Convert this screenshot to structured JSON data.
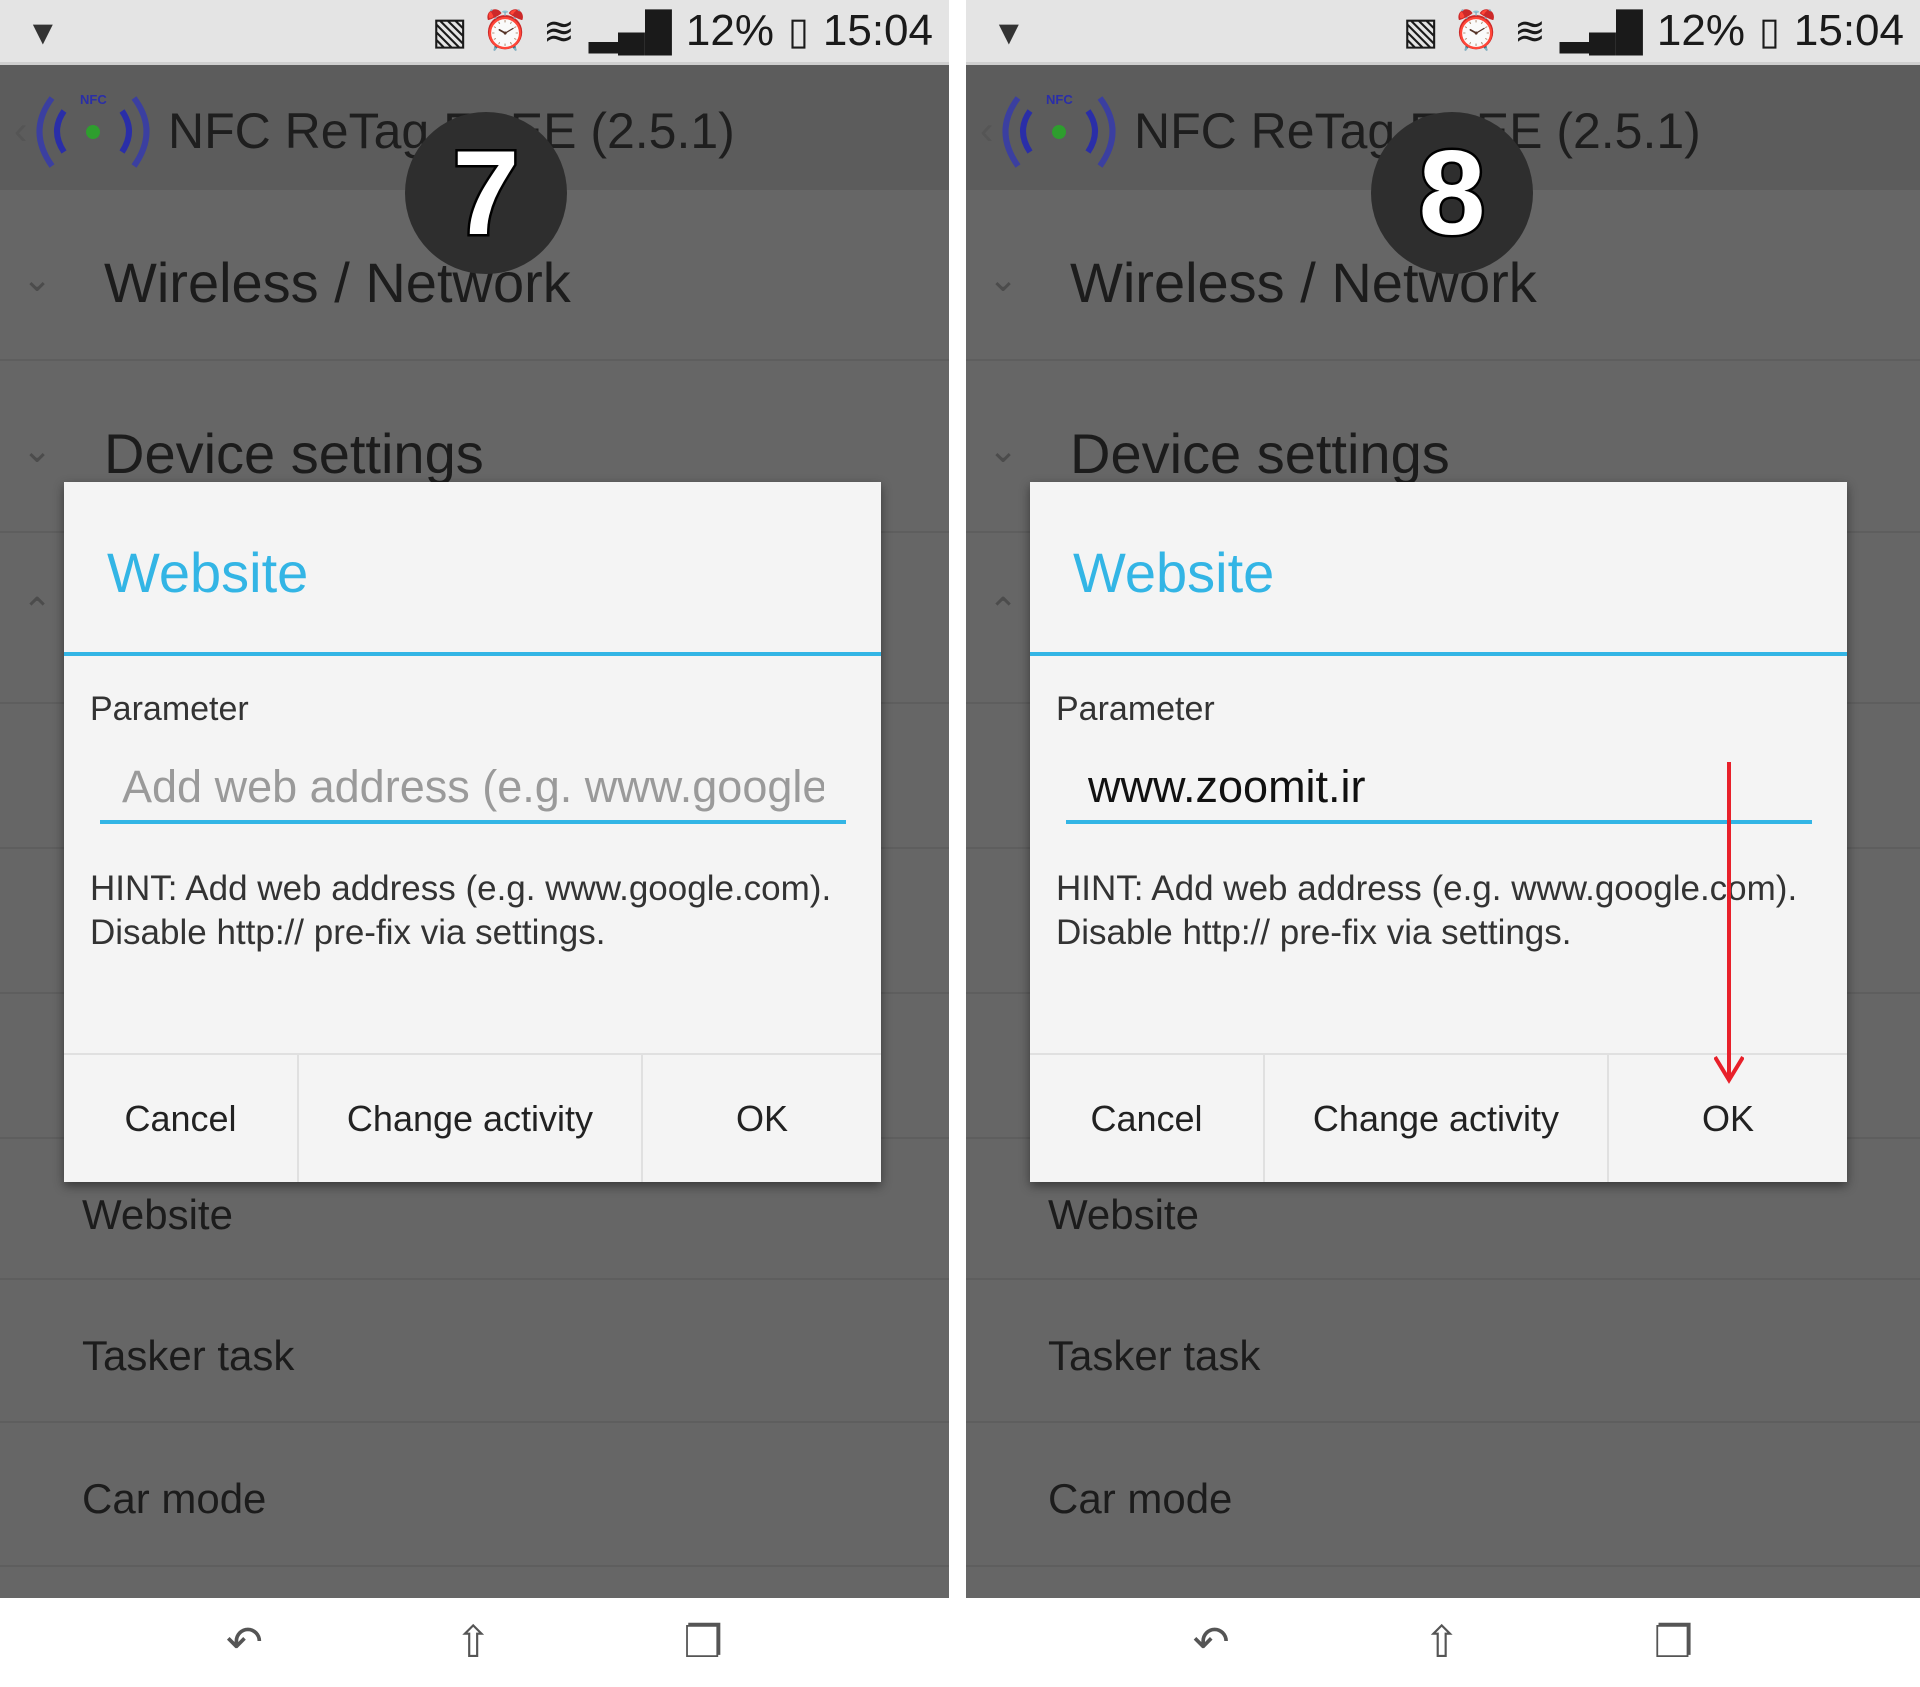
{
  "status_bar": {
    "battery": "12%",
    "time": "15:04",
    "icons": [
      "notification-icon",
      "vibrate-icon",
      "alarm-icon",
      "wifi-icon",
      "signal-icon",
      "battery-icon"
    ]
  },
  "app": {
    "title": "NFC ReTag FREE (2.5.1)",
    "logo_text": "NFC"
  },
  "list": {
    "section1": "Wireless / Network",
    "section2": "Device settings",
    "item1": "Website",
    "item2": "Tasker task",
    "item3": "Car mode"
  },
  "dialog": {
    "title": "Website",
    "parameter_label": "Parameter",
    "placeholder": "Add web address (e.g. www.google.com)",
    "hint": "HINT: Add web address (e.g. www.google.com). Disable http:// pre-fix via settings.",
    "cancel": "Cancel",
    "change_activity": "Change activity",
    "ok": "OK"
  },
  "panels": [
    {
      "step": "7",
      "input_value": ""
    },
    {
      "step": "8",
      "input_value": "www.zoomit.ir"
    }
  ],
  "colors": {
    "accent": "#33b5e5",
    "arrow": "#e8202a"
  }
}
